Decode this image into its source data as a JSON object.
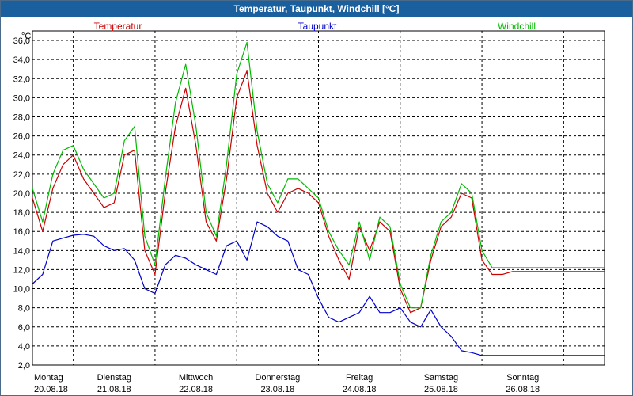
{
  "window": {
    "title": "Temperatur, Taupunkt, Windchill [°C]"
  },
  "colors": {
    "temperatur": "#cc0000",
    "taupunkt": "#0000cc",
    "windchill": "#00bb00",
    "titlebar": "#1a5f9e"
  },
  "chart_data": {
    "type": "line",
    "title": "Temperatur, Taupunkt, Windchill [°C]",
    "ylabel": "°C",
    "ylim": [
      2,
      37
    ],
    "y_ticks": [
      "36,0",
      "34,0",
      "32,0",
      "30,0",
      "28,0",
      "26,0",
      "24,0",
      "22,0",
      "20,0",
      "18,0",
      "16,0",
      "14,0",
      "12,0",
      "10,0",
      "8,0",
      "6,0",
      "4,0",
      "2,0"
    ],
    "x_ticks": [
      {
        "day": "Montag",
        "date": "20.08.18"
      },
      {
        "day": "Dienstag",
        "date": "21.08.18"
      },
      {
        "day": "Mittwoch",
        "date": "22.08.18"
      },
      {
        "day": "Donnerstag",
        "date": "23.08.18"
      },
      {
        "day": "Freitag",
        "date": "24.08.18"
      },
      {
        "day": "Samstag",
        "date": "25.08.18"
      },
      {
        "day": "Sonntag",
        "date": "26.08.18"
      }
    ],
    "grid": true,
    "x": [
      "20.08.18 00:00",
      "20.08.18 03:00",
      "20.08.18 06:00",
      "20.08.18 09:00",
      "20.08.18 12:00",
      "20.08.18 15:00",
      "20.08.18 18:00",
      "20.08.18 21:00",
      "21.08.18 00:00",
      "21.08.18 03:00",
      "21.08.18 06:00",
      "21.08.18 09:00",
      "21.08.18 12:00",
      "21.08.18 15:00",
      "21.08.18 18:00",
      "21.08.18 21:00",
      "22.08.18 00:00",
      "22.08.18 03:00",
      "22.08.18 06:00",
      "22.08.18 09:00",
      "22.08.18 12:00",
      "22.08.18 15:00",
      "22.08.18 18:00",
      "22.08.18 21:00",
      "23.08.18 00:00",
      "23.08.18 03:00",
      "23.08.18 06:00",
      "23.08.18 09:00",
      "23.08.18 12:00",
      "23.08.18 15:00",
      "23.08.18 18:00",
      "23.08.18 21:00",
      "24.08.18 00:00",
      "24.08.18 03:00",
      "24.08.18 06:00",
      "24.08.18 09:00",
      "24.08.18 12:00",
      "24.08.18 15:00",
      "24.08.18 18:00",
      "24.08.18 21:00",
      "25.08.18 00:00",
      "25.08.18 03:00",
      "25.08.18 06:00",
      "25.08.18 09:00",
      "25.08.18 12:00",
      "25.08.18 15:00",
      "25.08.18 18:00",
      "25.08.18 21:00",
      "26.08.18 00:00",
      "26.08.18 03:00",
      "26.08.18 06:00",
      "26.08.18 09:00",
      "26.08.18 12:00",
      "26.08.18 15:00",
      "26.08.18 18:00",
      "26.08.18 21:00",
      "27.08.18 00:00"
    ],
    "series": [
      {
        "name": "Temperatur",
        "color": "#cc0000",
        "values": [
          19.5,
          16.0,
          20.5,
          23.0,
          24.0,
          21.5,
          20.0,
          18.5,
          19.0,
          24.0,
          24.5,
          14.0,
          11.5,
          20.0,
          27.0,
          31.0,
          25.0,
          17.0,
          15.0,
          21.5,
          30.0,
          32.8,
          25.0,
          20.0,
          18.0,
          20.0,
          20.5,
          20.0,
          19.0,
          15.5,
          13.0,
          11.0,
          16.5,
          14.0,
          17.0,
          16.0,
          10.0,
          7.5,
          8.0,
          13.0,
          16.5,
          17.5,
          20.0,
          19.5,
          13.0,
          11.5,
          11.5,
          11.8,
          11.8,
          11.8,
          11.8,
          11.8,
          11.8,
          11.8,
          11.8,
          11.8,
          11.8
        ]
      },
      {
        "name": "Taupunkt",
        "color": "#0000cc",
        "values": [
          10.5,
          11.5,
          15.0,
          15.3,
          15.6,
          15.7,
          15.5,
          14.5,
          14.0,
          14.2,
          13.0,
          10.0,
          9.5,
          12.5,
          13.5,
          13.2,
          12.5,
          12.0,
          11.5,
          14.5,
          15.0,
          13.0,
          17.0,
          16.5,
          15.5,
          15.0,
          12.0,
          11.5,
          9.0,
          7.0,
          6.5,
          7.0,
          7.5,
          9.2,
          7.5,
          7.5,
          8.0,
          6.5,
          6.0,
          7.8,
          6.0,
          5.0,
          3.5,
          3.3,
          3.0,
          3.0,
          3.0,
          3.0,
          3.0,
          3.0,
          3.0,
          3.0,
          3.0,
          3.0,
          3.0,
          3.0,
          3.0
        ]
      },
      {
        "name": "Windchill",
        "color": "#00bb00",
        "values": [
          20.5,
          17.0,
          22.0,
          24.5,
          25.0,
          22.5,
          21.0,
          19.5,
          20.0,
          25.5,
          27.0,
          15.5,
          12.5,
          21.5,
          29.5,
          33.5,
          27.0,
          18.0,
          15.5,
          23.0,
          32.5,
          35.8,
          26.5,
          21.0,
          19.0,
          21.5,
          21.5,
          20.5,
          19.5,
          16.0,
          14.0,
          12.5,
          17.0,
          13.0,
          17.5,
          16.5,
          10.5,
          8.0,
          8.0,
          13.5,
          17.0,
          18.0,
          21.0,
          20.0,
          14.0,
          12.2,
          12.2,
          12.2,
          12.2,
          12.2,
          12.2,
          12.2,
          12.2,
          12.2,
          12.2,
          12.2,
          12.2
        ]
      }
    ]
  }
}
